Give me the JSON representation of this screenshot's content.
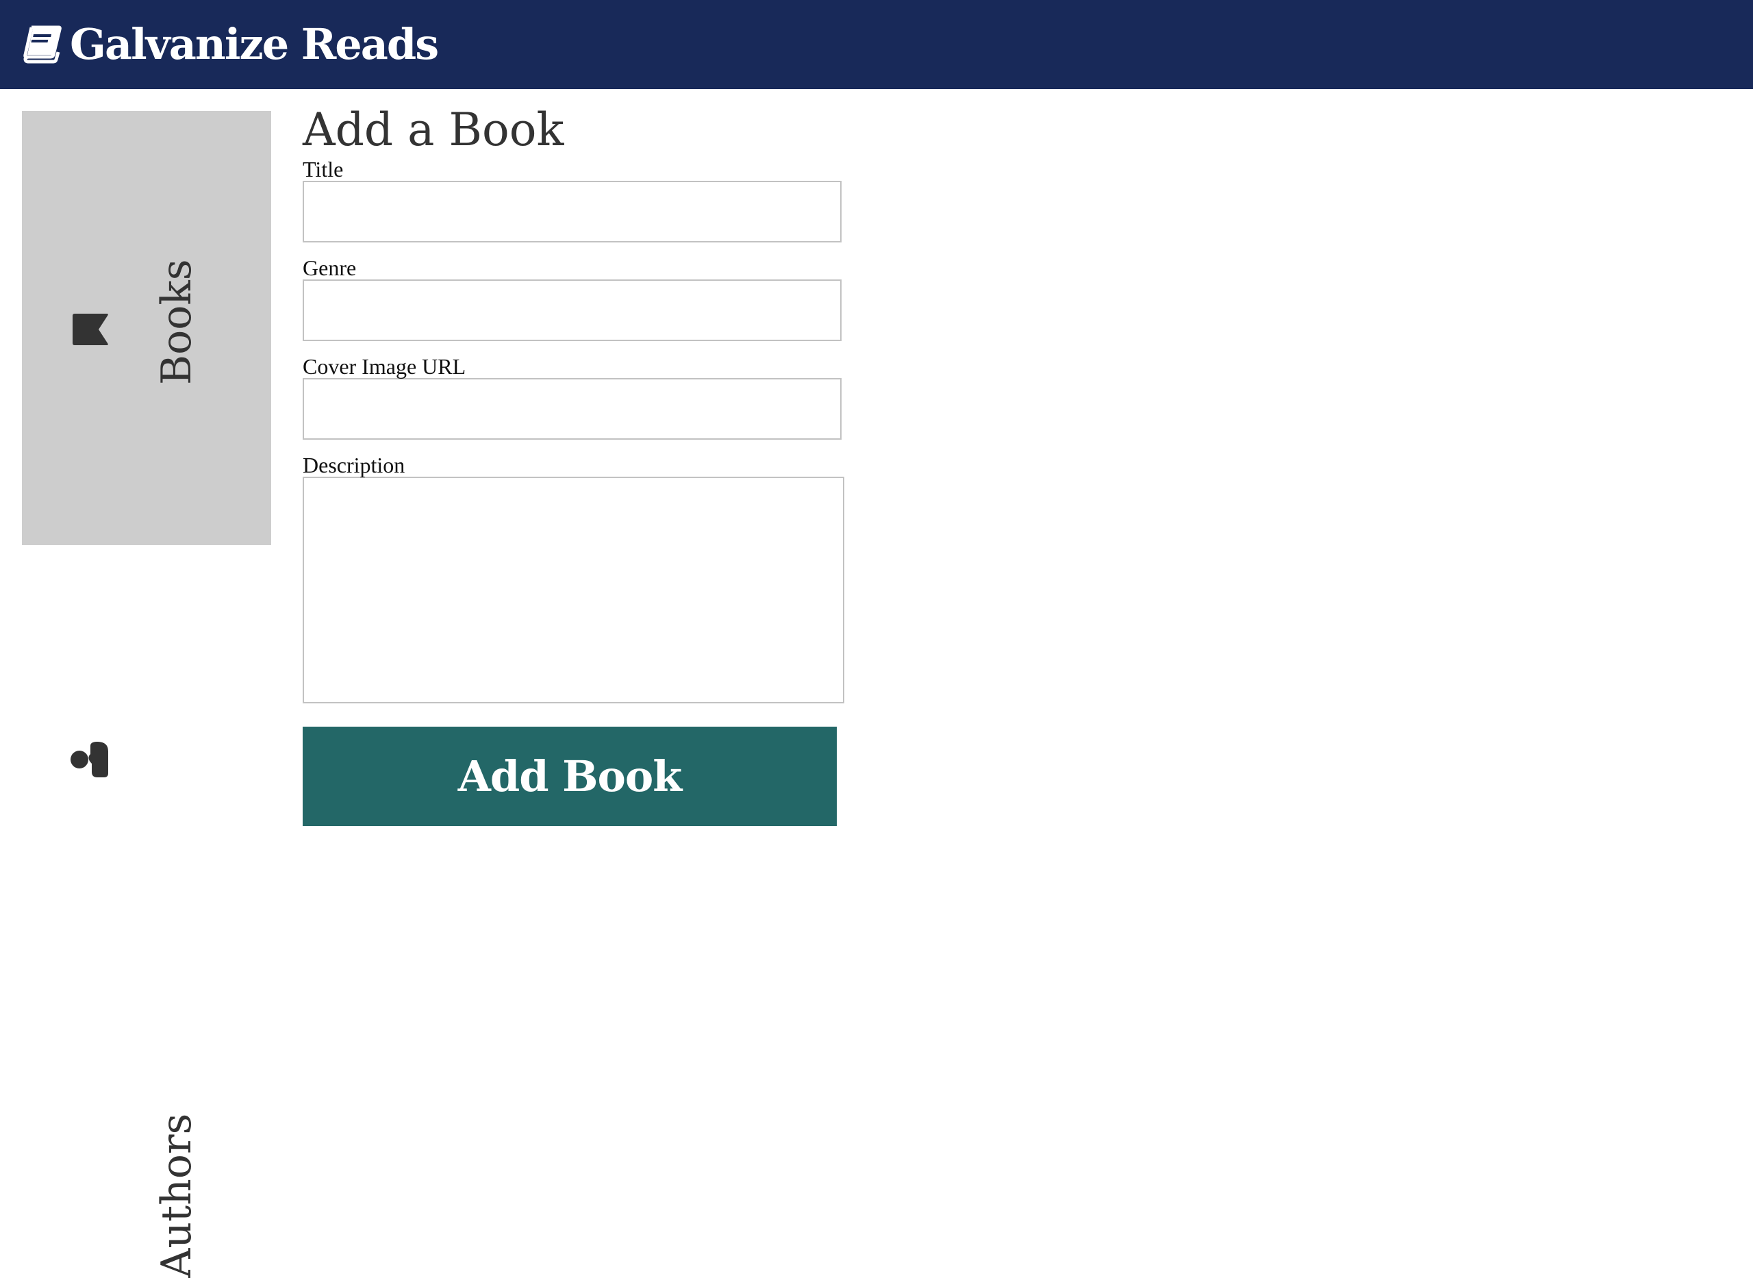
{
  "header": {
    "logo_icon": "book-icon",
    "title": "Galvanize Reads"
  },
  "sidebar": {
    "items": [
      {
        "label": "Books",
        "icon": "bookmark-flag-icon",
        "active": true
      },
      {
        "label": "Authors",
        "icon": "users-icon",
        "active": false
      }
    ]
  },
  "main": {
    "title": "Add a Book",
    "form": {
      "title_label": "Title",
      "title_value": "",
      "genre_label": "Genre",
      "genre_value": "",
      "cover_label": "Cover Image URL",
      "cover_value": "",
      "description_label": "Description",
      "description_value": "",
      "submit_label": "Add Book"
    }
  },
  "colors": {
    "header_bg": "#182959",
    "active_nav_bg": "#cdcdcd",
    "button_bg": "#236767"
  }
}
